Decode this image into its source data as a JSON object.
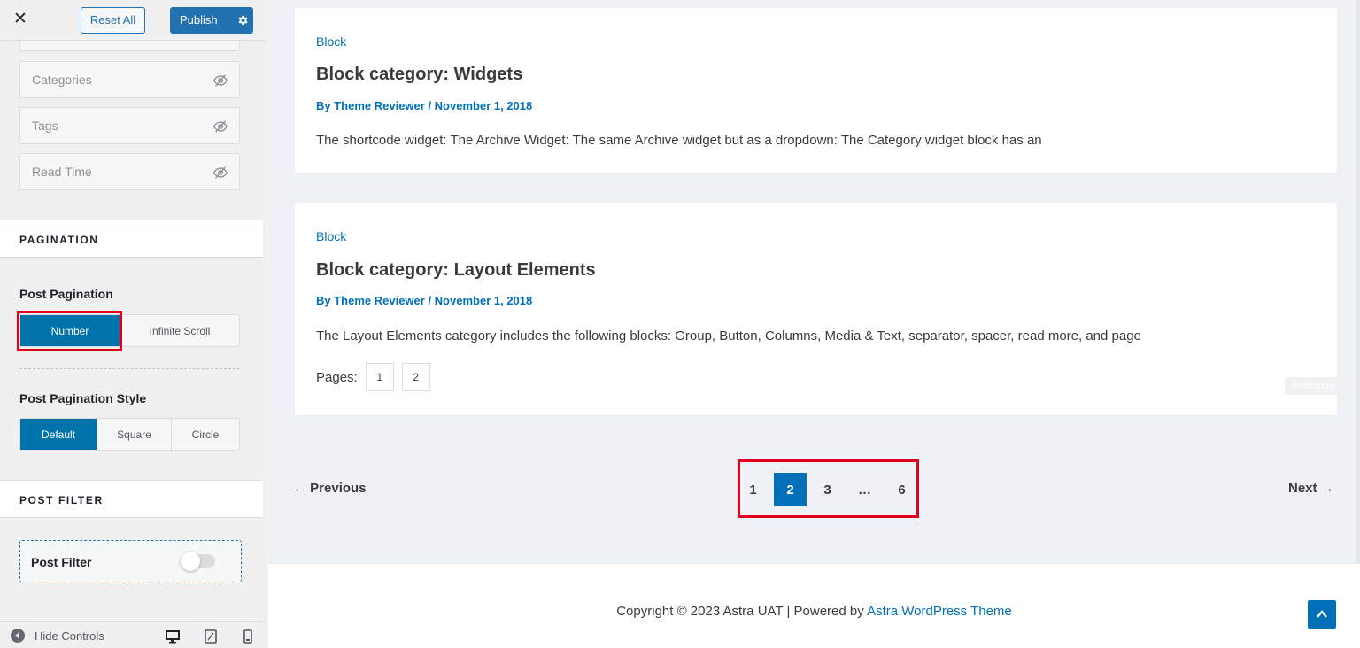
{
  "customizer": {
    "close_label": "✕",
    "reset_label": "Reset All",
    "publish_label": "Publish",
    "meta_items": [
      "Categories",
      "Tags",
      "Read Time"
    ],
    "pagination_section": "PAGINATION",
    "post_pagination": {
      "title": "Post Pagination",
      "options": [
        "Number",
        "Infinite Scroll"
      ],
      "selected": "Number"
    },
    "post_pagination_style": {
      "title": "Post Pagination Style",
      "options": [
        "Default",
        "Square",
        "Circle"
      ],
      "selected": "Default"
    },
    "post_filter_section": "POST FILTER",
    "post_filter": {
      "label": "Post Filter",
      "enabled": false
    },
    "hide_controls_label": "Hide Controls"
  },
  "preview": {
    "posts": [
      {
        "category": "Block",
        "title": "Block category: Widgets",
        "meta": "By Theme Reviewer / November 1, 2018",
        "excerpt": "The shortcode widget: The Archive Widget: The same Archive widget but as a dropdown: The Category widget block has an"
      },
      {
        "category": "Block",
        "title": "Block category: Layout Elements",
        "meta": "By Theme Reviewer / November 1, 2018",
        "excerpt": "The Layout Elements category includes the following blocks: Group, Button, Columns, Media & Text, separator, spacer, read more, and page",
        "pages_label": "Pages:",
        "pages": [
          "1",
          "2"
        ]
      }
    ],
    "rectangle_tag": "Rectangle",
    "nav": {
      "previous": "← Previous",
      "next": "Next →",
      "pages": [
        "1",
        "2",
        "3",
        "…",
        "6"
      ],
      "current": "2"
    },
    "footer": {
      "copyright_prefix": "Copyright © 2023 Astra UAT | Powered by ",
      "copyright_link": "Astra WordPress Theme"
    }
  },
  "colors": {
    "wp_blue": "#2271b1",
    "active_option": "#0073aa",
    "link_blue": "#0170b9",
    "highlight_red": "#e0001b"
  }
}
